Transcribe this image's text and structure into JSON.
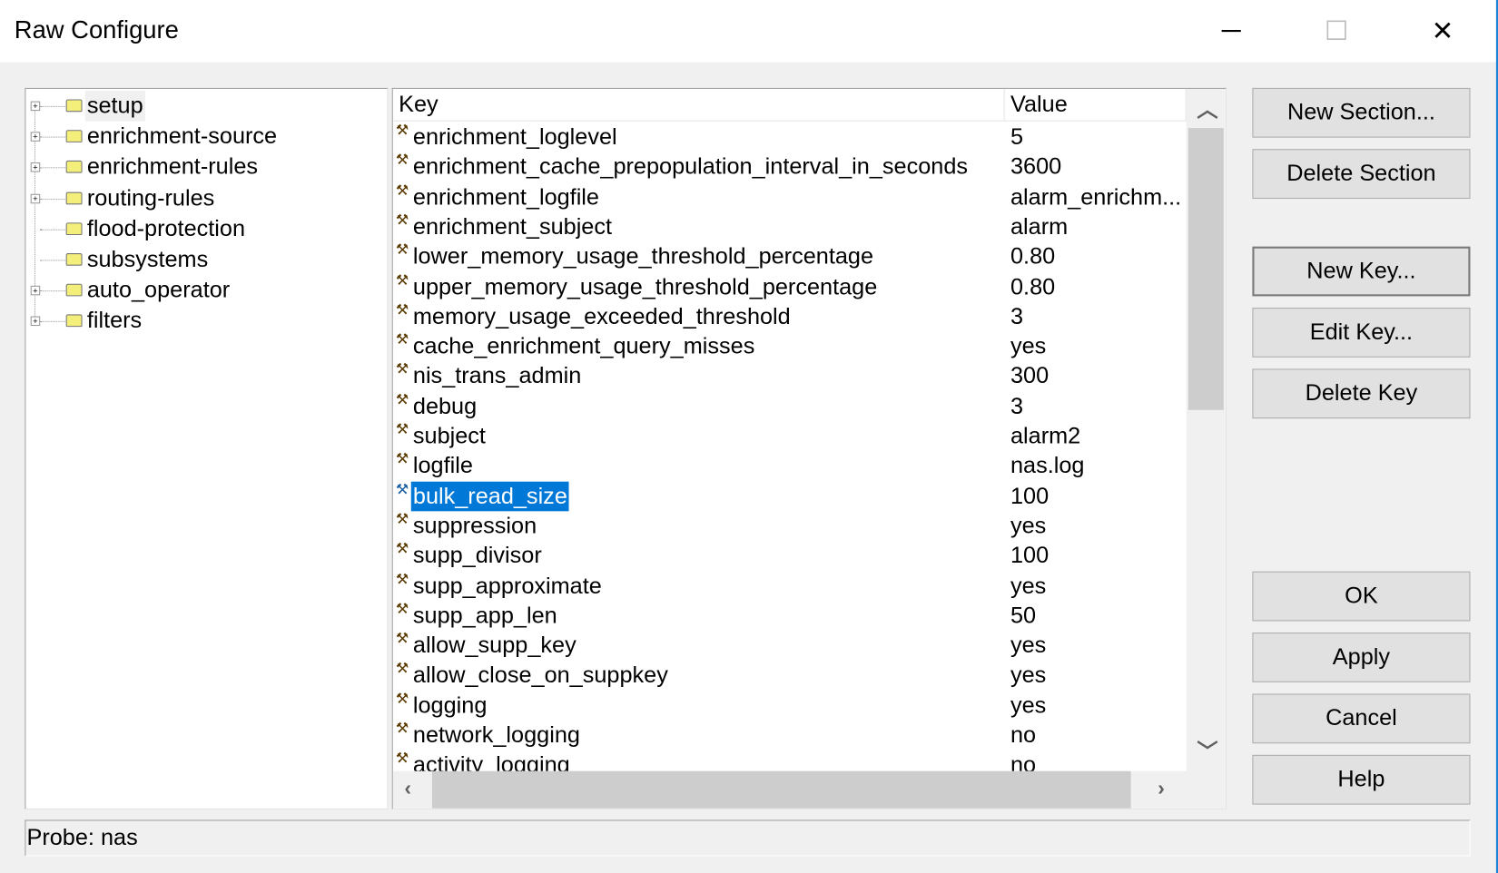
{
  "window": {
    "title": "Raw Configure",
    "minimize": "─",
    "maximize": "☐",
    "close": "✕"
  },
  "tree": [
    {
      "label": "setup",
      "expandable": true,
      "selected": true
    },
    {
      "label": "enrichment-source",
      "expandable": true
    },
    {
      "label": "enrichment-rules",
      "expandable": true
    },
    {
      "label": "routing-rules",
      "expandable": true
    },
    {
      "label": "flood-protection",
      "expandable": false
    },
    {
      "label": "subsystems",
      "expandable": false
    },
    {
      "label": "auto_operator",
      "expandable": true
    },
    {
      "label": "filters",
      "expandable": true
    }
  ],
  "list": {
    "columns": {
      "key": "Key",
      "value": "Value"
    },
    "rows": [
      {
        "key": "enrichment_loglevel",
        "value": "5"
      },
      {
        "key": "enrichment_cache_prepopulation_interval_in_seconds",
        "value": "3600"
      },
      {
        "key": "enrichment_logfile",
        "value": "alarm_enrichm..."
      },
      {
        "key": "enrichment_subject",
        "value": "alarm"
      },
      {
        "key": "lower_memory_usage_threshold_percentage",
        "value": "0.80"
      },
      {
        "key": "upper_memory_usage_threshold_percentage",
        "value": "0.80"
      },
      {
        "key": "memory_usage_exceeded_threshold",
        "value": "3"
      },
      {
        "key": "cache_enrichment_query_misses",
        "value": "yes"
      },
      {
        "key": "nis_trans_admin",
        "value": "300"
      },
      {
        "key": "debug",
        "value": "3"
      },
      {
        "key": "subject",
        "value": "alarm2"
      },
      {
        "key": "logfile",
        "value": "nas.log"
      },
      {
        "key": "bulk_read_size",
        "value": "100",
        "selected": true
      },
      {
        "key": "suppression",
        "value": "yes"
      },
      {
        "key": "supp_divisor",
        "value": "100"
      },
      {
        "key": "supp_approximate",
        "value": "yes"
      },
      {
        "key": "supp_app_len",
        "value": "50"
      },
      {
        "key": "allow_supp_key",
        "value": "yes"
      },
      {
        "key": "allow_close_on_suppkey",
        "value": "yes"
      },
      {
        "key": "logging",
        "value": "yes"
      },
      {
        "key": "network_logging",
        "value": "no"
      },
      {
        "key": "activity_logging",
        "value": "no"
      }
    ]
  },
  "buttons": {
    "new_section": "New Section...",
    "delete_section": "Delete Section",
    "new_key": "New Key...",
    "edit_key": "Edit Key...",
    "delete_key": "Delete Key",
    "ok": "OK",
    "apply": "Apply",
    "cancel": "Cancel",
    "help": "Help"
  },
  "status": "Probe: nas",
  "colors": {
    "selection": "#0078d7",
    "window_border": "#1883d7"
  }
}
